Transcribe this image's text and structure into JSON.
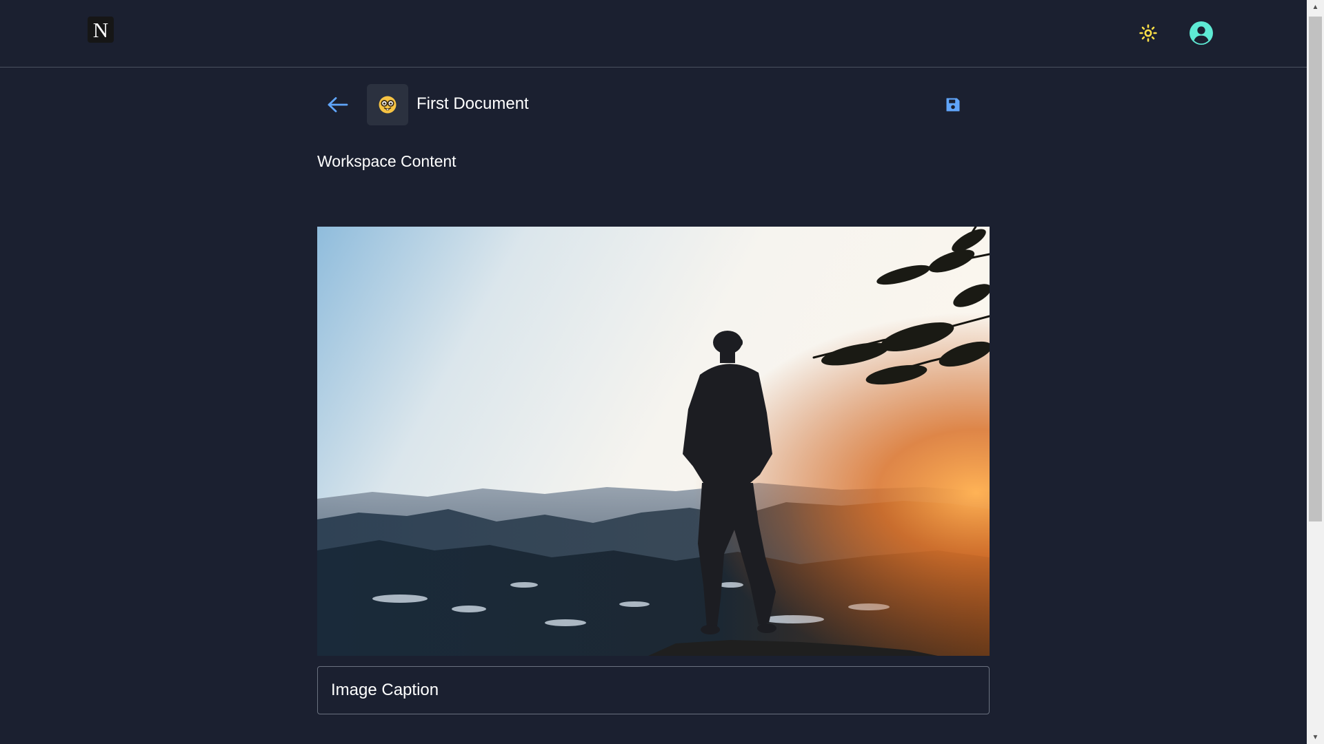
{
  "header": {
    "logo_letter": "N",
    "theme_icon": "sun-icon",
    "profile_icon": "user-circle-icon",
    "theme_color": "#fde047",
    "profile_color": "#5eead4"
  },
  "document": {
    "back_icon": "arrow-left-icon",
    "emoji_icon": "nerd-face-icon",
    "title": "First Document",
    "save_icon": "save-icon",
    "accent_color": "#60a5fa"
  },
  "content": {
    "heading": "Workspace Content",
    "image_description": "Person standing on a cliff overlooking mountains at sunset",
    "caption_placeholder": "Image Caption",
    "caption_value": ""
  }
}
